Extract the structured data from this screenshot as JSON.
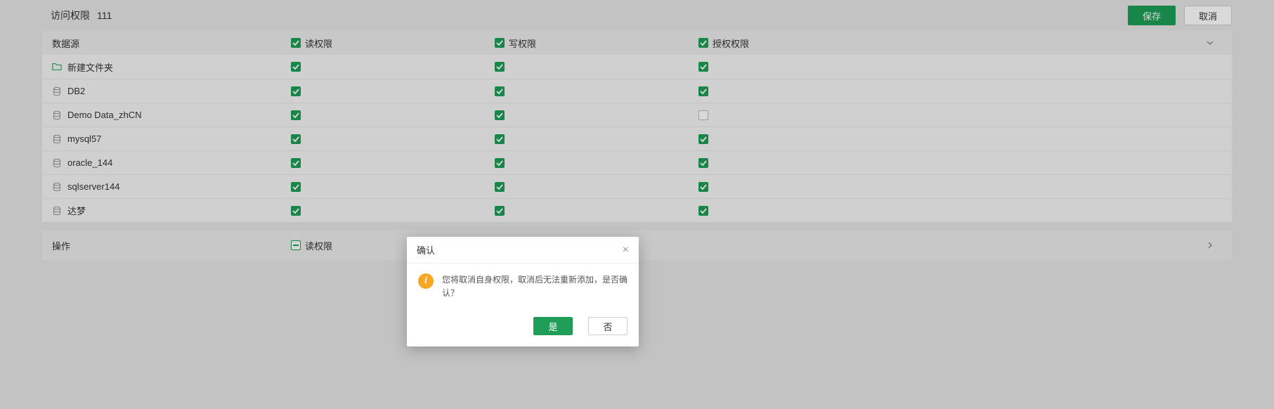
{
  "header": {
    "title": "访问权限",
    "subtitle": "111",
    "save_label": "保存",
    "cancel_label": "取消"
  },
  "table": {
    "columns": {
      "datasource": "数据源",
      "read": "读权限",
      "write": "写权限",
      "grant": "授权权限"
    },
    "header_checks": {
      "read": true,
      "write": true,
      "grant": true
    },
    "rows": [
      {
        "icon": "folder",
        "name": "新建文件夹",
        "read": true,
        "write": true,
        "grant": true
      },
      {
        "icon": "db",
        "name": "DB2",
        "read": true,
        "write": true,
        "grant": true
      },
      {
        "icon": "db",
        "name": "Demo Data_zhCN",
        "read": true,
        "write": true,
        "grant": false
      },
      {
        "icon": "db",
        "name": "mysql57",
        "read": true,
        "write": true,
        "grant": true
      },
      {
        "icon": "db",
        "name": "oracle_144",
        "read": true,
        "write": true,
        "grant": true
      },
      {
        "icon": "db",
        "name": "sqlserver144",
        "read": true,
        "write": true,
        "grant": true
      },
      {
        "icon": "db",
        "name": "达梦",
        "read": true,
        "write": true,
        "grant": true
      }
    ]
  },
  "operation_section": {
    "title": "操作",
    "read_label": "读权限"
  },
  "modal": {
    "title": "确认",
    "message": "您将取消自身权限，取消后无法重新添加，是否确认？",
    "yes": "是",
    "no": "否"
  }
}
